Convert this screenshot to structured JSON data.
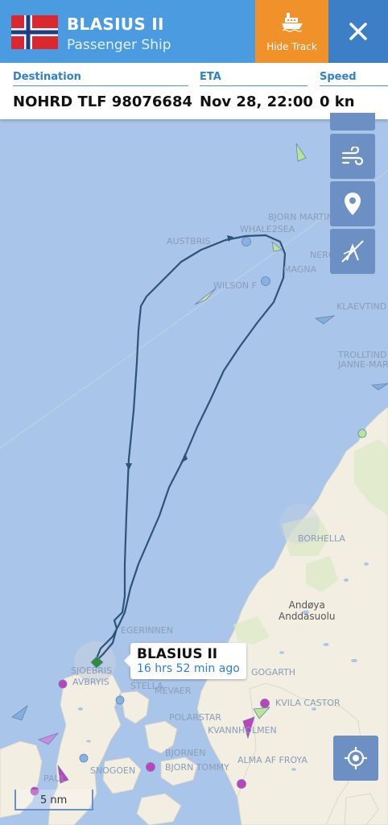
{
  "header": {
    "ship_name": "BLASIUS II",
    "ship_type": "Passenger Ship",
    "hide_track_label": "Hide Track",
    "flag": "norway-flag-icon"
  },
  "info": {
    "destination_label": "Destination",
    "destination_value": "NOHRD TLF 98076684",
    "eta_label": "ETA",
    "eta_value": "Nov 28, 22:00",
    "speed_label": "Speed",
    "speed_value": "0 kn"
  },
  "map": {
    "ship_popup_name": "BLASIUS II",
    "ship_popup_time": "16 hrs 52 min ago",
    "scale_label": "5 nm",
    "place_names": [
      "Andøya",
      "Anddasuolu"
    ],
    "vessel_labels": [
      "AUSTBRIS",
      "WHALE2SEA",
      "BJORN MARTIN",
      "WILSON F",
      "MAGNA",
      "KLAEVTIND",
      "TROLLTIND",
      "JANNE-MARI",
      "BORHELLA",
      "EGERINNEN",
      "SJOEBRIS",
      "AVBRYIS",
      "STELLA",
      "MEVAER",
      "GOGARTH",
      "POLARSTAR",
      "KVANNHOLMEN",
      "BJORNEN",
      "BJORN TOMMY",
      "ALMA AF FROYA",
      "SNOGOEN",
      "KVILA CASTOR",
      "NERO",
      "PAUL"
    ],
    "colors": {
      "sea": "#a9c6ea",
      "land": "#f2efe2",
      "track": "#2d5478",
      "header": "#4a9be0",
      "hide_track": "#f0912a",
      "close": "#3c7fc6"
    }
  }
}
